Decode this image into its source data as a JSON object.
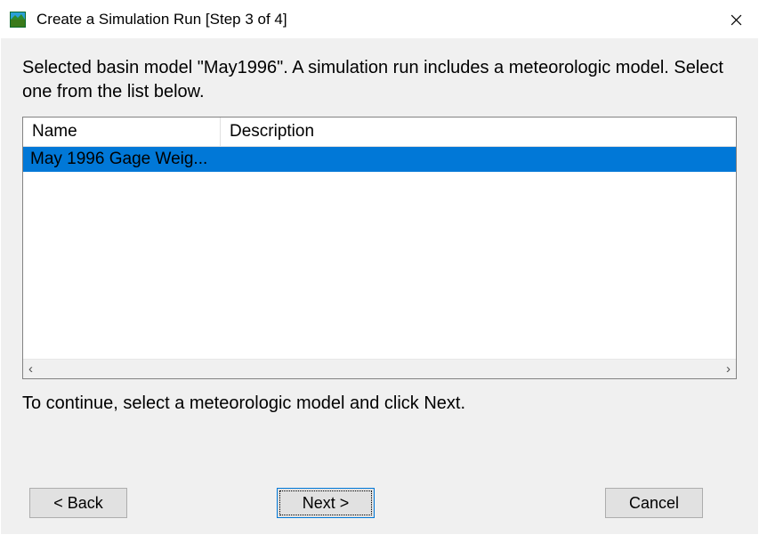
{
  "window": {
    "title": "Create a Simulation Run [Step 3 of 4]"
  },
  "instruction": "Selected basin model \"May1996\". A simulation run includes a meteorologic model. Select one from the list below.",
  "table": {
    "columns": {
      "name": "Name",
      "description": "Description"
    },
    "rows": [
      {
        "name": "May 1996 Gage Weig...",
        "description": "",
        "selected": true
      }
    ]
  },
  "hint": "To continue, select a meteorologic model and click Next.",
  "buttons": {
    "back": "< Back",
    "next": "Next >",
    "cancel": "Cancel"
  }
}
